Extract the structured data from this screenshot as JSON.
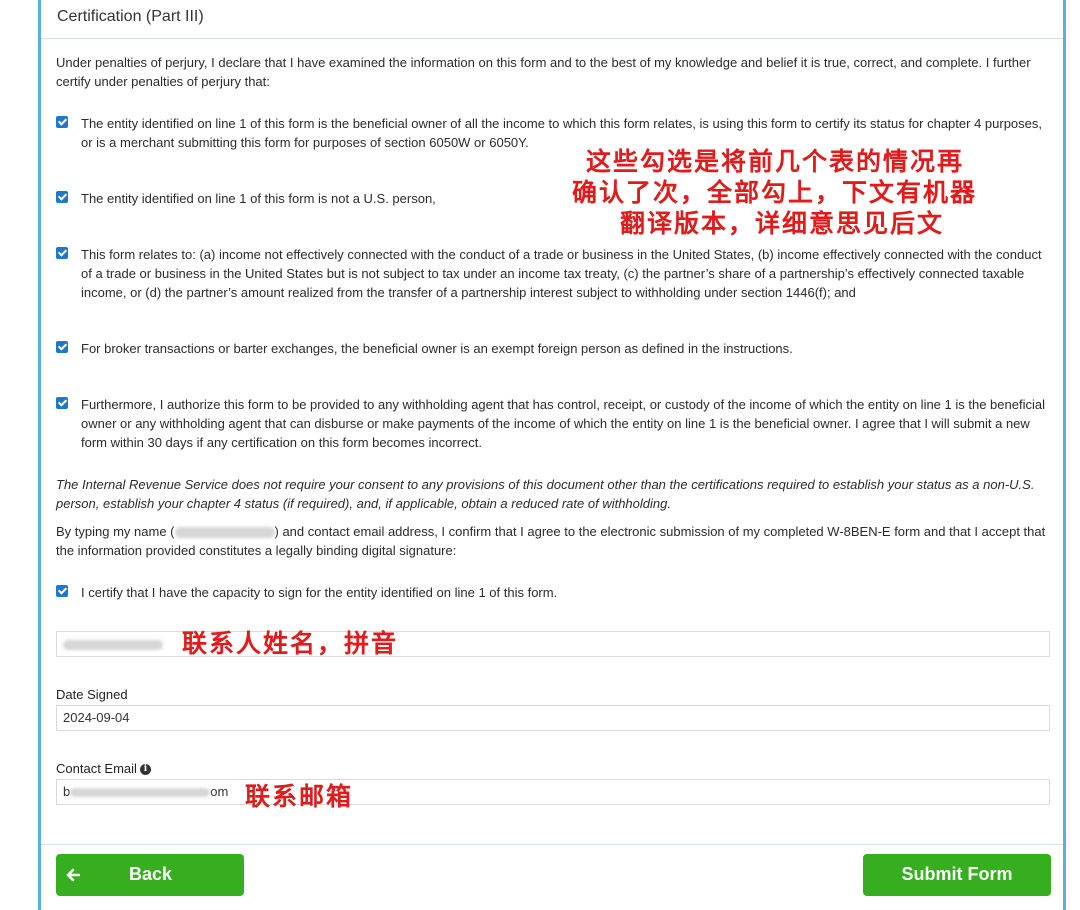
{
  "section": {
    "title": "Certification (Part III)"
  },
  "intro": "Under penalties of perjury, I declare that I have examined the information on this form and to the best of my knowledge and belief it is true, correct, and complete. I further certify under penalties of perjury that:",
  "checkboxes": [
    {
      "checked": true,
      "text": "The entity identified on line 1 of this form is the beneficial owner of all the income to which this form relates, is using this form to certify its status for chapter 4 purposes, or is a merchant submitting this form for purposes of section 6050W or 6050Y."
    },
    {
      "checked": true,
      "text": "The entity identified on line 1 of this form is not a U.S. person,"
    },
    {
      "checked": true,
      "text": "This form relates to: (a) income not effectively connected with the conduct of a trade or business in the United States, (b) income effectively connected with the conduct of a trade or business in the United States but is not subject to tax under an income tax treaty, (c) the partner’s share of a partnership’s effectively connected taxable income, or (d) the partner’s amount realized from the transfer of a partnership interest subject to withholding under section 1446(f); and"
    },
    {
      "checked": true,
      "text": "For broker transactions or barter exchanges, the beneficial owner is an exempt foreign person as defined in the instructions."
    },
    {
      "checked": true,
      "text": "Furthermore, I authorize this form to be provided to any withholding agent that has control, receipt, or custody of the income of which the entity on line 1 is the beneficial owner or any withholding agent that can disburse or make payments of the income of which the entity on line 1 is the beneficial owner. I agree that I will submit a new form within 30 days if any certification on this form becomes incorrect."
    }
  ],
  "irs_note": "The Internal Revenue Service does not require your consent to any provisions of this document other than the certifications required to establish your status as a non-U.S. person, establish your chapter 4 status (if required), and, if applicable, obtain a reduced rate of withholding.",
  "consent": {
    "before": "By typing my name (",
    "after": ") and contact email address, I confirm that I agree to the electronic submission of my completed W-8BEN-E form and that I accept that the information provided constitutes a legally binding digital signature:"
  },
  "capacity": {
    "checked": true,
    "text": "I certify that I have the capacity to sign for the entity identified on line 1 of this form."
  },
  "fields": {
    "date_label": "Date Signed",
    "date_value": "2024-09-04",
    "email_label": "Contact Email",
    "email_start": "b",
    "email_end": "om"
  },
  "buttons": {
    "back": "Back",
    "submit": "Submit Form",
    "back_icon": "arrow-left-icon"
  },
  "annotations": {
    "checkbox_note": [
      "这些勾选是将前几个表的情况再",
      "确认了次，全部勾上，下文有机器",
      "翻译版本，详细意思见后文"
    ],
    "name_note": "联系人姓名，拼音",
    "email_note": "联系邮箱"
  },
  "colors": {
    "accent_border": "#5ab0e0",
    "checkbox": "#1f78c8",
    "button": "#36ae1f",
    "annotation": "#e01b1b"
  }
}
